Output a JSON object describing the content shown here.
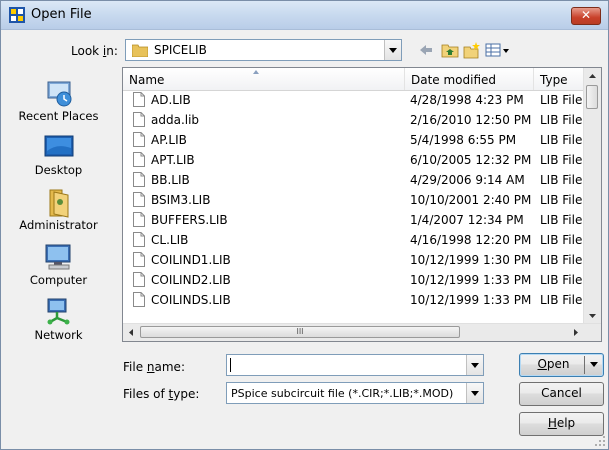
{
  "window": {
    "title": "Open File",
    "close_glyph": "✕"
  },
  "look_in": {
    "label_pre": "Look ",
    "label_key": "i",
    "label_post": "n:",
    "value": "SPICELIB"
  },
  "toolbar": {
    "back": "back-icon",
    "up": "up-folder-icon",
    "new_folder": "new-folder-icon",
    "views": "views-icon"
  },
  "places": [
    {
      "label": "Recent Places",
      "icon": "recent-places-icon"
    },
    {
      "label": "Desktop",
      "icon": "desktop-icon"
    },
    {
      "label": "Administrator",
      "icon": "user-folder-icon"
    },
    {
      "label": "Computer",
      "icon": "computer-icon"
    },
    {
      "label": "Network",
      "icon": "network-icon"
    }
  ],
  "columns": {
    "name": "Name",
    "date": "Date modified",
    "type": "Type"
  },
  "files": [
    {
      "name": "AD.LIB",
      "date": "4/28/1998 4:23 PM",
      "type": "LIB File"
    },
    {
      "name": "adda.lib",
      "date": "2/16/2010 12:50 PM",
      "type": "LIB File"
    },
    {
      "name": "AP.LIB",
      "date": "5/4/1998 6:55 PM",
      "type": "LIB File"
    },
    {
      "name": "APT.LIB",
      "date": "6/10/2005 12:32 PM",
      "type": "LIB File"
    },
    {
      "name": "BB.LIB",
      "date": "4/29/2006 9:14 AM",
      "type": "LIB File"
    },
    {
      "name": "BSIM3.LIB",
      "date": "10/10/2001 2:40 PM",
      "type": "LIB File"
    },
    {
      "name": "BUFFERS.LIB",
      "date": "1/4/2007 12:34 PM",
      "type": "LIB File"
    },
    {
      "name": "CL.LIB",
      "date": "4/16/1998 12:20 PM",
      "type": "LIB File"
    },
    {
      "name": "COILIND1.LIB",
      "date": "10/12/1999 1:30 PM",
      "type": "LIB File"
    },
    {
      "name": "COILIND2.LIB",
      "date": "10/12/1999 1:33 PM",
      "type": "LIB File"
    },
    {
      "name": "COILINDS.LIB",
      "date": "10/12/1999 1:33 PM",
      "type": "LIB File"
    }
  ],
  "scrollbar_grip": "III",
  "file_name": {
    "label_pre": "File ",
    "label_key": "n",
    "label_post": "ame:",
    "value": ""
  },
  "file_type": {
    "label_pre": "Files of ",
    "label_key": "t",
    "label_post": "ype:",
    "value": "PSpice subcircuit file (*.CIR;*.LIB;*.MOD)"
  },
  "buttons": {
    "open_key": "O",
    "open_rest": "pen",
    "cancel": "Cancel",
    "help_key": "H",
    "help_rest": "elp"
  }
}
